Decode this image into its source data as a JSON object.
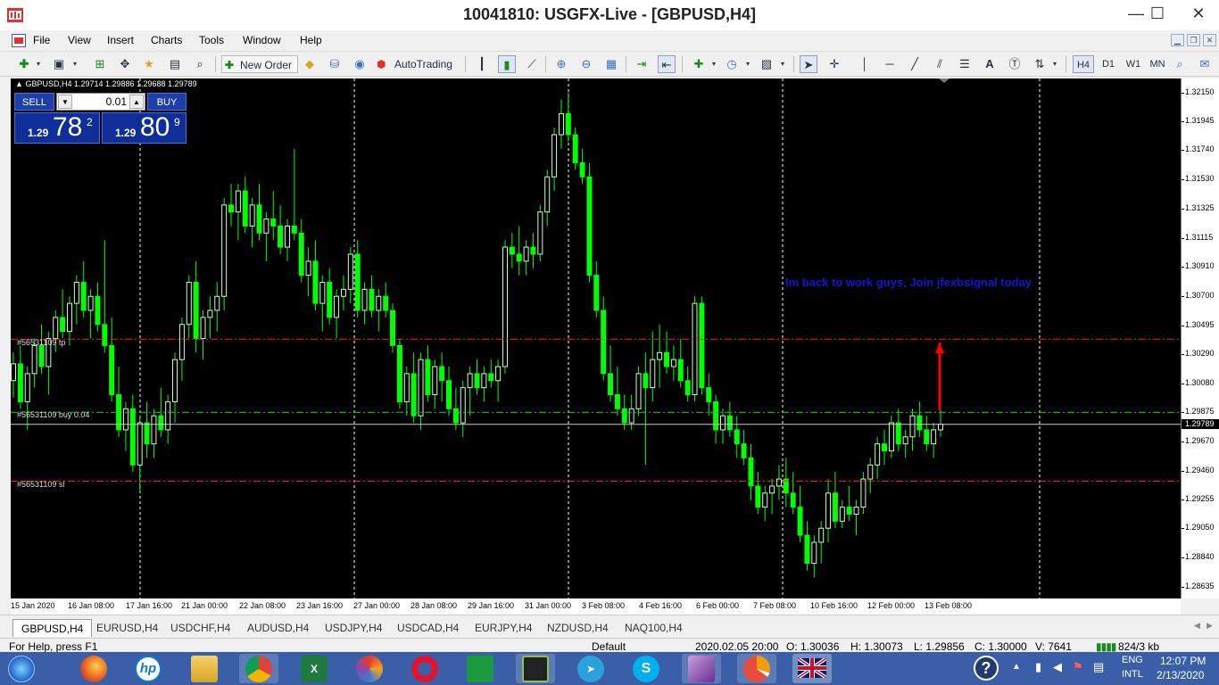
{
  "window": {
    "title": "10041810: USGFX-Live - [GBPUSD,H4]",
    "controls": {
      "minimize": "—",
      "maximize": "☐",
      "close": "✕"
    }
  },
  "menu": [
    "File",
    "View",
    "Insert",
    "Charts",
    "Tools",
    "Window",
    "Help"
  ],
  "toolbar": {
    "new_order": "New Order",
    "autotrading": "AutoTrading",
    "timeframes": [
      "H4",
      "D1",
      "W1",
      "MN"
    ]
  },
  "chart": {
    "info": "GBPUSD,H4  1.29714 1.29886 1.29688 1.29789",
    "one_click": {
      "sell": "SELL",
      "buy": "BUY",
      "lot": "0.01",
      "sell_prefix": "1.29",
      "sell_big": "78",
      "sell_sup": "2",
      "buy_prefix": "1.29",
      "buy_big": "80",
      "buy_sup": "9"
    },
    "order_lines": {
      "tp": "#56531109 tp",
      "buy": "#56531109 buy 0.04",
      "sl": "#56531109 sl"
    },
    "annotation": "Im back to work guys, Join jfexbsignal today",
    "current_price": "1.29789",
    "price_ticks": [
      "1.32150",
      "1.31945",
      "1.31740",
      "1.31530",
      "1.31325",
      "1.31115",
      "1.30910",
      "1.30700",
      "1.30495",
      "1.30290",
      "1.30080",
      "1.29875",
      "1.29670",
      "1.29460",
      "1.29255",
      "1.29050",
      "1.28840",
      "1.28635"
    ],
    "time_labels": [
      "15 Jan 2020",
      "16 Jan 08:00",
      "17 Jan 16:00",
      "21 Jan 00:00",
      "22 Jan 08:00",
      "23 Jan 16:00",
      "27 Jan 00:00",
      "28 Jan 08:00",
      "29 Jan 16:00",
      "31 Jan 00:00",
      "3 Feb 08:00",
      "4 Feb 16:00",
      "6 Feb 00:00",
      "7 Feb 08:00",
      "10 Feb 16:00",
      "12 Feb 00:00",
      "13 Feb 08:00"
    ],
    "colors": {
      "bull": "#ccffcc",
      "bear": "#00ff00",
      "sl_tp": "#ff2020",
      "entry": "#22cc22",
      "grid": "#ffffff",
      "annotation": "#1414d8",
      "arrow": "#ff0000"
    }
  },
  "chart_data": {
    "type": "candlestick",
    "symbol": "GBPUSD",
    "timeframe": "H4",
    "ylim": [
      1.2855,
      1.3225
    ],
    "levels": {
      "tp": 1.30395,
      "entry": 1.29875,
      "sl": 1.29385,
      "current": 1.29789
    },
    "candles": [
      [
        1.301,
        1.303,
        1.2998,
        1.3022
      ],
      [
        1.3022,
        1.3035,
        1.299,
        1.2995
      ],
      [
        1.2995,
        1.302,
        1.2975,
        1.3015
      ],
      [
        1.3015,
        1.304,
        1.3005,
        1.3035
      ],
      [
        1.3035,
        1.305,
        1.3015,
        1.302
      ],
      [
        1.302,
        1.3045,
        1.3,
        1.304
      ],
      [
        1.304,
        1.306,
        1.303,
        1.3055
      ],
      [
        1.3055,
        1.3075,
        1.304,
        1.3045
      ],
      [
        1.3045,
        1.307,
        1.3035,
        1.3065
      ],
      [
        1.3065,
        1.3085,
        1.305,
        1.308
      ],
      [
        1.308,
        1.3095,
        1.3055,
        1.306
      ],
      [
        1.306,
        1.3075,
        1.304,
        1.307
      ],
      [
        1.307,
        1.308,
        1.3045,
        1.305
      ],
      [
        1.305,
        1.311,
        1.303,
        1.3035
      ],
      [
        1.3035,
        1.3055,
        1.2995,
        1.3
      ],
      [
        1.3,
        1.302,
        1.297,
        1.2975
      ],
      [
        1.2975,
        1.2995,
        1.296,
        1.299
      ],
      [
        1.299,
        1.3,
        1.2945,
        1.295
      ],
      [
        1.295,
        1.2985,
        1.293,
        1.298
      ],
      [
        1.298,
        1.2995,
        1.2955,
        1.2965
      ],
      [
        1.2965,
        1.299,
        1.2955,
        1.2985
      ],
      [
        1.2985,
        1.3005,
        1.297,
        1.2975
      ],
      [
        1.2975,
        1.3,
        1.2965,
        1.2995
      ],
      [
        1.2995,
        1.303,
        1.298,
        1.3025
      ],
      [
        1.3025,
        1.3055,
        1.301,
        1.305
      ],
      [
        1.305,
        1.3085,
        1.304,
        1.308
      ],
      [
        1.308,
        1.3095,
        1.303,
        1.304
      ],
      [
        1.304,
        1.306,
        1.3025,
        1.3055
      ],
      [
        1.3055,
        1.307,
        1.304,
        1.306
      ],
      [
        1.306,
        1.308,
        1.3045,
        1.307
      ],
      [
        1.307,
        1.314,
        1.306,
        1.3135
      ],
      [
        1.3135,
        1.315,
        1.312,
        1.313
      ],
      [
        1.313,
        1.315,
        1.311,
        1.3145
      ],
      [
        1.3145,
        1.3155,
        1.3115,
        1.312
      ],
      [
        1.312,
        1.314,
        1.3105,
        1.3135
      ],
      [
        1.3135,
        1.315,
        1.311,
        1.3115
      ],
      [
        1.3115,
        1.313,
        1.3095,
        1.3125
      ],
      [
        1.3125,
        1.3145,
        1.311,
        1.312
      ],
      [
        1.312,
        1.3135,
        1.31,
        1.3105
      ],
      [
        1.3105,
        1.3125,
        1.3095,
        1.312
      ],
      [
        1.312,
        1.3175,
        1.311,
        1.3115
      ],
      [
        1.3115,
        1.3125,
        1.308,
        1.3085
      ],
      [
        1.3085,
        1.3105,
        1.307,
        1.3095
      ],
      [
        1.3095,
        1.311,
        1.306,
        1.3065
      ],
      [
        1.3065,
        1.3085,
        1.3045,
        1.308
      ],
      [
        1.308,
        1.309,
        1.305,
        1.3055
      ],
      [
        1.3055,
        1.3075,
        1.304,
        1.307
      ],
      [
        1.307,
        1.3085,
        1.306,
        1.3075
      ],
      [
        1.3075,
        1.3105,
        1.3065,
        1.31
      ],
      [
        1.31,
        1.311,
        1.3055,
        1.306
      ],
      [
        1.306,
        1.308,
        1.305,
        1.3075
      ],
      [
        1.3075,
        1.3085,
        1.3055,
        1.306
      ],
      [
        1.306,
        1.3075,
        1.3045,
        1.307
      ],
      [
        1.307,
        1.308,
        1.3055,
        1.306
      ],
      [
        1.306,
        1.3065,
        1.303,
        1.3035
      ],
      [
        1.3035,
        1.304,
        1.299,
        1.2995
      ],
      [
        1.2995,
        1.302,
        1.2985,
        1.3015
      ],
      [
        1.3015,
        1.303,
        1.298,
        1.2985
      ],
      [
        1.2985,
        1.303,
        1.2975,
        1.3025
      ],
      [
        1.3025,
        1.3035,
        1.2995,
        1.3
      ],
      [
        1.3,
        1.3025,
        1.299,
        1.302
      ],
      [
        1.302,
        1.303,
        1.2995,
        1.301
      ],
      [
        1.301,
        1.302,
        1.2985,
        1.299
      ],
      [
        1.299,
        1.3005,
        1.2975,
        1.298
      ],
      [
        1.298,
        1.301,
        1.297,
        1.3005
      ],
      [
        1.3005,
        1.302,
        1.2985,
        1.3015
      ],
      [
        1.3015,
        1.3025,
        1.3,
        1.3005
      ],
      [
        1.3005,
        1.302,
        1.2995,
        1.3015
      ],
      [
        1.3015,
        1.3025,
        1.3005,
        1.301
      ],
      [
        1.301,
        1.3025,
        1.2995,
        1.302
      ],
      [
        1.302,
        1.311,
        1.3015,
        1.3105
      ],
      [
        1.3105,
        1.3115,
        1.309,
        1.31
      ],
      [
        1.31,
        1.312,
        1.3085,
        1.3095
      ],
      [
        1.3095,
        1.311,
        1.3085,
        1.3105
      ],
      [
        1.3105,
        1.3115,
        1.309,
        1.31
      ],
      [
        1.31,
        1.3135,
        1.3095,
        1.313
      ],
      [
        1.313,
        1.316,
        1.312,
        1.3155
      ],
      [
        1.3155,
        1.319,
        1.3145,
        1.3185
      ],
      [
        1.3185,
        1.321,
        1.3175,
        1.32
      ],
      [
        1.32,
        1.3215,
        1.318,
        1.3185
      ],
      [
        1.3185,
        1.319,
        1.316,
        1.3165
      ],
      [
        1.3165,
        1.3175,
        1.315,
        1.3155
      ],
      [
        1.3155,
        1.3165,
        1.308,
        1.3085
      ],
      [
        1.3085,
        1.3095,
        1.3055,
        1.306
      ],
      [
        1.306,
        1.307,
        1.301,
        1.3015
      ],
      [
        1.3015,
        1.3035,
        1.2995,
        1.3
      ],
      [
        1.3,
        1.302,
        1.2985,
        1.299
      ],
      [
        1.299,
        1.3,
        1.2975,
        1.298
      ],
      [
        1.298,
        1.3,
        1.2975,
        1.299
      ],
      [
        1.299,
        1.302,
        1.2985,
        1.3015
      ],
      [
        1.3015,
        1.303,
        1.295,
        1.3005
      ],
      [
        1.3005,
        1.3045,
        1.2995,
        1.3025
      ],
      [
        1.3025,
        1.305,
        1.3005,
        1.303
      ],
      [
        1.303,
        1.3045,
        1.3015,
        1.302
      ],
      [
        1.302,
        1.3035,
        1.301,
        1.3025
      ],
      [
        1.3025,
        1.304,
        1.3005,
        1.301
      ],
      [
        1.301,
        1.302,
        1.2995,
        1.3
      ],
      [
        1.3,
        1.307,
        1.2995,
        1.3065
      ],
      [
        1.3065,
        1.307,
        1.3,
        1.3005
      ],
      [
        1.3005,
        1.3015,
        1.2985,
        1.2995
      ],
      [
        1.2995,
        1.3,
        1.2965,
        1.2975
      ],
      [
        1.2975,
        1.299,
        1.2965,
        1.2985
      ],
      [
        1.2985,
        1.2995,
        1.297,
        1.2975
      ],
      [
        1.2975,
        1.2985,
        1.2955,
        1.2965
      ],
      [
        1.2965,
        1.2975,
        1.295,
        1.2955
      ],
      [
        1.2955,
        1.2965,
        1.2925,
        1.2935
      ],
      [
        1.2935,
        1.2945,
        1.2915,
        1.292
      ],
      [
        1.292,
        1.2935,
        1.291,
        1.293
      ],
      [
        1.293,
        1.294,
        1.2915,
        1.2935
      ],
      [
        1.2935,
        1.295,
        1.2925,
        1.294
      ],
      [
        1.294,
        1.2955,
        1.292,
        1.293
      ],
      [
        1.293,
        1.2945,
        1.2915,
        1.292
      ],
      [
        1.292,
        1.2935,
        1.2895,
        1.29
      ],
      [
        1.29,
        1.291,
        1.2875,
        1.288
      ],
      [
        1.288,
        1.29,
        1.287,
        1.2895
      ],
      [
        1.2895,
        1.291,
        1.288,
        1.2905
      ],
      [
        1.2905,
        1.294,
        1.2895,
        1.293
      ],
      [
        1.293,
        1.2945,
        1.2905,
        1.291
      ],
      [
        1.291,
        1.2925,
        1.2905,
        1.292
      ],
      [
        1.292,
        1.2935,
        1.291,
        1.2915
      ],
      [
        1.2915,
        1.2925,
        1.29,
        1.292
      ],
      [
        1.292,
        1.2945,
        1.2915,
        1.294
      ],
      [
        1.294,
        1.2955,
        1.293,
        1.295
      ],
      [
        1.295,
        1.297,
        1.294,
        1.2965
      ],
      [
        1.2965,
        1.2975,
        1.295,
        1.296
      ],
      [
        1.296,
        1.2985,
        1.2955,
        1.298
      ],
      [
        1.298,
        1.299,
        1.296,
        1.2965
      ],
      [
        1.2965,
        1.2975,
        1.2955,
        1.297
      ],
      [
        1.297,
        1.299,
        1.296,
        1.2985
      ],
      [
        1.2985,
        1.2995,
        1.297,
        1.2975
      ],
      [
        1.2975,
        1.2985,
        1.296,
        1.2965
      ],
      [
        1.2965,
        1.298,
        1.2955,
        1.2975
      ],
      [
        1.2975,
        1.299,
        1.297,
        1.2979
      ]
    ]
  },
  "tabs": [
    "GBPUSD,H4",
    "EURUSD,H4",
    "USDCHF,H4",
    "AUDUSD,H4",
    "USDJPY,H4",
    "USDCAD,H4",
    "EURJPY,H4",
    "NZDUSD,H4",
    "NAQ100,H4"
  ],
  "status": {
    "help": "For Help, press F1",
    "profile": "Default",
    "datetime": "2020.02.05 20:00",
    "open": "O: 1.30036",
    "high": "H: 1.30073",
    "low": "L: 1.29856",
    "close": "C: 1.30000",
    "volume": "V: 7641",
    "traffic": "824/3 kb"
  },
  "tray": {
    "lang": "ENG",
    "layout": "INTL",
    "time": "12:07 PM",
    "date": "2/13/2020"
  },
  "taskbar_apps": [
    "start-icon",
    "firefox-icon",
    "hp-icon",
    "file-explorer-icon",
    "chrome-icon",
    "excel-icon",
    "swirl-app-icon",
    "opera-icon",
    "store-icon",
    "etisalat-icon",
    "telegram-icon",
    "skype-icon",
    "gem-app-icon",
    "pie-app-icon",
    "uk-flag-icon"
  ]
}
